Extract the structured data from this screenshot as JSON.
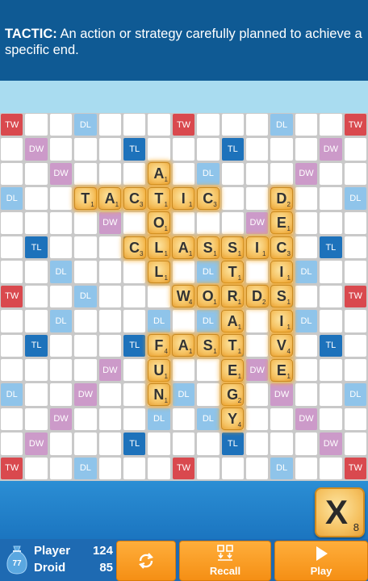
{
  "definition": {
    "word": "TACTIC:",
    "text": " An action or strategy carefully planned to achieve a specific end."
  },
  "board": {
    "size": 15,
    "premium_squares": [
      {
        "r": 0,
        "c": 0,
        "t": "TW"
      },
      {
        "r": 0,
        "c": 3,
        "t": "DL"
      },
      {
        "r": 0,
        "c": 7,
        "t": "TW"
      },
      {
        "r": 0,
        "c": 11,
        "t": "DL"
      },
      {
        "r": 0,
        "c": 14,
        "t": "TW"
      },
      {
        "r": 1,
        "c": 1,
        "t": "DW"
      },
      {
        "r": 1,
        "c": 5,
        "t": "TL"
      },
      {
        "r": 1,
        "c": 9,
        "t": "TL"
      },
      {
        "r": 1,
        "c": 13,
        "t": "DW"
      },
      {
        "r": 2,
        "c": 2,
        "t": "DW"
      },
      {
        "r": 2,
        "c": 6,
        "t": "DL"
      },
      {
        "r": 2,
        "c": 8,
        "t": "DL"
      },
      {
        "r": 2,
        "c": 12,
        "t": "DW"
      },
      {
        "r": 3,
        "c": 0,
        "t": "DL"
      },
      {
        "r": 3,
        "c": 3,
        "t": "DW"
      },
      {
        "r": 3,
        "c": 7,
        "t": "DL"
      },
      {
        "r": 3,
        "c": 11,
        "t": "DW"
      },
      {
        "r": 3,
        "c": 14,
        "t": "DL"
      },
      {
        "r": 4,
        "c": 4,
        "t": "DW"
      },
      {
        "r": 4,
        "c": 10,
        "t": "DW"
      },
      {
        "r": 5,
        "c": 1,
        "t": "TL"
      },
      {
        "r": 5,
        "c": 5,
        "t": "TL"
      },
      {
        "r": 5,
        "c": 9,
        "t": "TL"
      },
      {
        "r": 5,
        "c": 13,
        "t": "TL"
      },
      {
        "r": 6,
        "c": 2,
        "t": "DL"
      },
      {
        "r": 6,
        "c": 6,
        "t": "DL"
      },
      {
        "r": 6,
        "c": 8,
        "t": "DL"
      },
      {
        "r": 6,
        "c": 12,
        "t": "DL"
      },
      {
        "r": 7,
        "c": 0,
        "t": "TW"
      },
      {
        "r": 7,
        "c": 3,
        "t": "DL"
      },
      {
        "r": 7,
        "c": 11,
        "t": "DL"
      },
      {
        "r": 7,
        "c": 14,
        "t": "TW"
      },
      {
        "r": 8,
        "c": 2,
        "t": "DL"
      },
      {
        "r": 8,
        "c": 6,
        "t": "DL"
      },
      {
        "r": 8,
        "c": 8,
        "t": "DL"
      },
      {
        "r": 8,
        "c": 12,
        "t": "DL"
      },
      {
        "r": 9,
        "c": 1,
        "t": "TL"
      },
      {
        "r": 9,
        "c": 5,
        "t": "TL"
      },
      {
        "r": 9,
        "c": 9,
        "t": "TL"
      },
      {
        "r": 9,
        "c": 13,
        "t": "TL"
      },
      {
        "r": 10,
        "c": 4,
        "t": "DW"
      },
      {
        "r": 10,
        "c": 10,
        "t": "DW"
      },
      {
        "r": 11,
        "c": 0,
        "t": "DL"
      },
      {
        "r": 11,
        "c": 3,
        "t": "DW"
      },
      {
        "r": 11,
        "c": 7,
        "t": "DL"
      },
      {
        "r": 11,
        "c": 11,
        "t": "DW"
      },
      {
        "r": 11,
        "c": 14,
        "t": "DL"
      },
      {
        "r": 12,
        "c": 2,
        "t": "DW"
      },
      {
        "r": 12,
        "c": 6,
        "t": "DL"
      },
      {
        "r": 12,
        "c": 8,
        "t": "DL"
      },
      {
        "r": 12,
        "c": 12,
        "t": "DW"
      },
      {
        "r": 13,
        "c": 1,
        "t": "DW"
      },
      {
        "r": 13,
        "c": 5,
        "t": "TL"
      },
      {
        "r": 13,
        "c": 9,
        "t": "TL"
      },
      {
        "r": 13,
        "c": 13,
        "t": "DW"
      },
      {
        "r": 14,
        "c": 0,
        "t": "TW"
      },
      {
        "r": 14,
        "c": 3,
        "t": "DL"
      },
      {
        "r": 14,
        "c": 7,
        "t": "TW"
      },
      {
        "r": 14,
        "c": 11,
        "t": "DL"
      },
      {
        "r": 14,
        "c": 14,
        "t": "TW"
      }
    ],
    "tiles": [
      {
        "r": 2,
        "c": 6,
        "l": "A",
        "p": "1"
      },
      {
        "r": 3,
        "c": 3,
        "l": "T",
        "p": "1"
      },
      {
        "r": 3,
        "c": 4,
        "l": "A",
        "p": "1"
      },
      {
        "r": 3,
        "c": 5,
        "l": "C",
        "p": "3"
      },
      {
        "r": 3,
        "c": 6,
        "l": "T",
        "p": "1"
      },
      {
        "r": 3,
        "c": 7,
        "l": "I",
        "p": "1"
      },
      {
        "r": 3,
        "c": 8,
        "l": "C",
        "p": "3"
      },
      {
        "r": 3,
        "c": 11,
        "l": "D",
        "p": "2"
      },
      {
        "r": 4,
        "c": 6,
        "l": "O",
        "p": "1"
      },
      {
        "r": 4,
        "c": 11,
        "l": "E",
        "p": "1"
      },
      {
        "r": 5,
        "c": 5,
        "l": "C",
        "p": "3"
      },
      {
        "r": 5,
        "c": 6,
        "l": "L",
        "p": "1"
      },
      {
        "r": 5,
        "c": 7,
        "l": "A",
        "p": "1"
      },
      {
        "r": 5,
        "c": 8,
        "l": "S",
        "p": "1"
      },
      {
        "r": 5,
        "c": 9,
        "l": "S",
        "p": "1"
      },
      {
        "r": 5,
        "c": 10,
        "l": "I",
        "p": "1"
      },
      {
        "r": 5,
        "c": 11,
        "l": "C",
        "p": "3"
      },
      {
        "r": 6,
        "c": 6,
        "l": "L",
        "p": "1"
      },
      {
        "r": 6,
        "c": 9,
        "l": "T",
        "p": "1"
      },
      {
        "r": 6,
        "c": 11,
        "l": "I",
        "p": "1"
      },
      {
        "r": 7,
        "c": 7,
        "l": "W",
        "p": "4"
      },
      {
        "r": 7,
        "c": 8,
        "l": "O",
        "p": "1"
      },
      {
        "r": 7,
        "c": 9,
        "l": "R",
        "p": "1"
      },
      {
        "r": 7,
        "c": 10,
        "l": "D",
        "p": "2"
      },
      {
        "r": 7,
        "c": 11,
        "l": "S",
        "p": "1"
      },
      {
        "r": 8,
        "c": 9,
        "l": "A",
        "p": "1"
      },
      {
        "r": 8,
        "c": 11,
        "l": "I",
        "p": "1"
      },
      {
        "r": 9,
        "c": 6,
        "l": "F",
        "p": "4"
      },
      {
        "r": 9,
        "c": 7,
        "l": "A",
        "p": "1"
      },
      {
        "r": 9,
        "c": 8,
        "l": "S",
        "p": "1"
      },
      {
        "r": 9,
        "c": 9,
        "l": "T",
        "p": "1"
      },
      {
        "r": 9,
        "c": 11,
        "l": "V",
        "p": "4"
      },
      {
        "r": 10,
        "c": 6,
        "l": "U",
        "p": "1"
      },
      {
        "r": 10,
        "c": 9,
        "l": "E",
        "p": "1"
      },
      {
        "r": 10,
        "c": 11,
        "l": "E",
        "p": "1"
      },
      {
        "r": 11,
        "c": 6,
        "l": "N",
        "p": "1"
      },
      {
        "r": 11,
        "c": 9,
        "l": "G",
        "p": "2"
      },
      {
        "r": 12,
        "c": 9,
        "l": "Y",
        "p": "4"
      }
    ]
  },
  "rack_tile": {
    "letter": "X",
    "points": "8"
  },
  "footer": {
    "bag_count": "77",
    "players": [
      {
        "name": "Player",
        "score": "124"
      },
      {
        "name": "Droid",
        "score": "85"
      }
    ],
    "buttons": {
      "shuffle_icon": "shuffle-icon",
      "recall_label": "Recall",
      "play_label": "Play"
    }
  },
  "colors": {
    "TW": "#d9494e",
    "DW": "#cc9ac9",
    "TL": "#1d72bb",
    "DL": "#8fc4ea",
    "button": "#f9a12a",
    "header": "#0f5a94"
  }
}
